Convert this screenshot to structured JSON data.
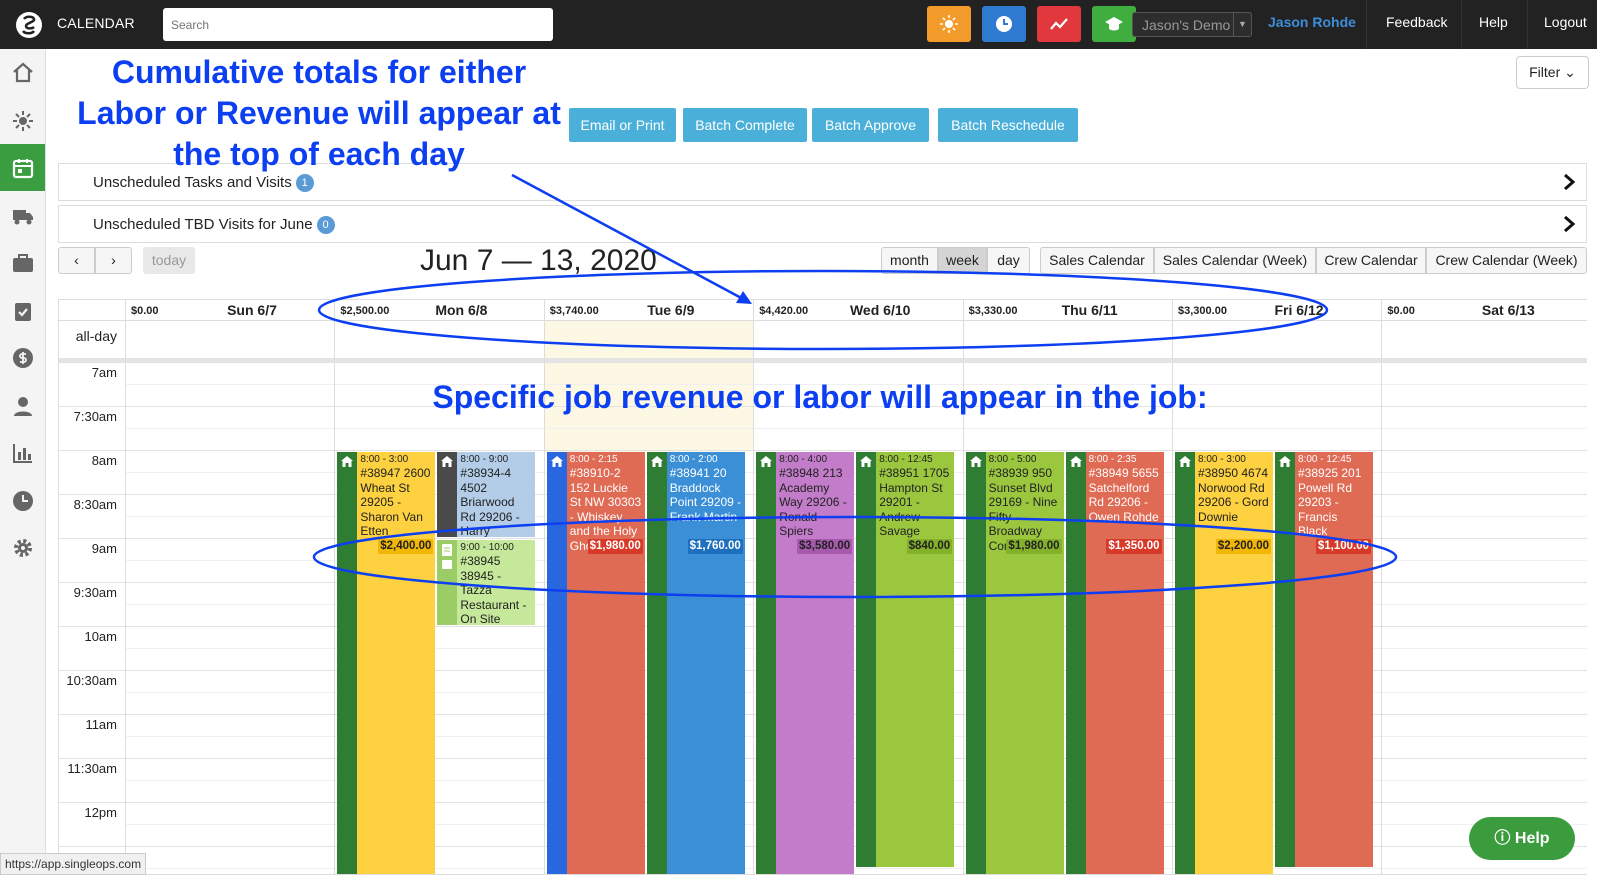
{
  "topbar": {
    "title": "CALENDAR",
    "search_placeholder": "Search",
    "account_select": "Jason's Demo",
    "user": "Jason Rohde",
    "links": [
      "Feedback",
      "Help",
      "Logout"
    ],
    "quick_buttons": [
      {
        "icon": "sun-icon",
        "color": "#f39c2b"
      },
      {
        "icon": "clock-icon",
        "color": "#2f7bd1"
      },
      {
        "icon": "chart-line-icon",
        "color": "#e0383d"
      },
      {
        "icon": "graduation-cap-icon",
        "color": "#3fae3f"
      }
    ]
  },
  "sidebar": {
    "icons": [
      "home-icon",
      "sun-icon",
      "calendar-icon",
      "truck-icon",
      "briefcase-icon",
      "clipboard-check-icon",
      "dollar-icon",
      "user-icon",
      "bar-chart-icon",
      "clock-icon",
      "gear-icon"
    ],
    "active": "calendar-icon",
    "collapse_icon": "arrow-right-icon"
  },
  "filter_label": "Filter",
  "actions": [
    "Email or Print",
    "Batch Complete",
    "Batch Approve",
    "Batch Reschedule"
  ],
  "unscheduled": [
    {
      "label": "Unscheduled Tasks and Visits",
      "count": "1"
    },
    {
      "label": "Unscheduled TBD Visits for June",
      "count": "0"
    }
  ],
  "toolbar": {
    "today": "today",
    "range": "Jun 7 — 13, 2020",
    "views": [
      "month",
      "week",
      "day"
    ],
    "active_view": "week",
    "calendars": [
      "Sales Calendar",
      "Sales Calendar (Week)",
      "Crew Calendar",
      "Crew Calendar (Week)"
    ]
  },
  "calendar": {
    "allday_label": "all-day",
    "days": [
      {
        "total": "$0.00",
        "name": "Sun 6/7"
      },
      {
        "total": "$2,500.00",
        "name": "Mon 6/8"
      },
      {
        "total": "$3,740.00",
        "name": "Tue 6/9"
      },
      {
        "total": "$4,420.00",
        "name": "Wed 6/10"
      },
      {
        "total": "$3,330.00",
        "name": "Thu 6/11"
      },
      {
        "total": "$3,300.00",
        "name": "Fri 6/12"
      },
      {
        "total": "$0.00",
        "name": "Sat 6/13"
      }
    ],
    "times": [
      "7am",
      "7:30am",
      "8am",
      "8:30am",
      "9am",
      "9:30am",
      "10am",
      "10:30am",
      "11am",
      "11:30am",
      "12pm"
    ],
    "events": [
      {
        "day": 1,
        "slot": 0,
        "time": "8:00 - 3:00",
        "text": "#38947 2600 Wheat St 29205 - Sharon Van Etten",
        "amount": "$2,400.00",
        "color": "#fdd13f",
        "strip": "#2e7d32",
        "amount_bg": "#f2b705",
        "light": false
      },
      {
        "day": 1,
        "slot": 1,
        "time": "8:00 - 9:00",
        "text": "#38934-4 4502 Briarwood Rd 29206 - Harry",
        "amount": "",
        "color": "#b3cde8",
        "strip": "#4a4a4a",
        "amount_bg": "",
        "light": false
      },
      {
        "day": 1,
        "slot": 1,
        "time": "9:00 - 10:00",
        "text": "#38945 38945 - Tazza Restaurant - On Site",
        "amount": "",
        "color": "#c5e89a",
        "strip": "#9ccc65",
        "amount_bg": "",
        "light": false
      },
      {
        "day": 2,
        "slot": 0,
        "time": "8:00 - 2:15",
        "text": "#38910-2 152 Luckie St NW 30303 - Whiskey and the Holy Ghost",
        "amount": "$1,980.00",
        "color": "#e06b55",
        "strip": "#2867e0",
        "amount_bg": "#d83a2a",
        "light": true
      },
      {
        "day": 2,
        "slot": 1,
        "time": "8:00 - 2:00",
        "text": "#38941 20 Braddock Point 29209 - Frank Martin",
        "amount": "$1,760.00",
        "color": "#3b8fd6",
        "strip": "#2e7d32",
        "amount_bg": "#1f6fbf",
        "light": true
      },
      {
        "day": 3,
        "slot": 0,
        "time": "8:00 - 4:00",
        "text": "#38948 213 Academy Way 29206 - Ronald Spiers",
        "amount": "$3,580.00",
        "color": "#c27cc9",
        "strip": "#2e7d32",
        "amount_bg": "#a659ad",
        "light": false
      },
      {
        "day": 3,
        "slot": 1,
        "time": "8:00 - 12:45",
        "text": "#38951 1705 Hampton St 29201 - Andrew Savage",
        "amount": "$840.00",
        "color": "#9bc73f",
        "strip": "#2e7d32",
        "amount_bg": "#84b12a",
        "light": false
      },
      {
        "day": 4,
        "slot": 0,
        "time": "8:00 - 5:00",
        "text": "#38939 950 Sunset Blvd 29169 - Nine Fifty Broadway Condos",
        "amount": "$1,980.00",
        "color": "#9bc73f",
        "strip": "#2e7d32",
        "amount_bg": "#84b12a",
        "light": false
      },
      {
        "day": 4,
        "slot": 1,
        "time": "8:00 - 2:35",
        "text": "#38949 5655 Satchelford Rd 29206 - Owen Rohde",
        "amount": "$1,350.00",
        "color": "#e06b55",
        "strip": "#2e7d32",
        "amount_bg": "#d83a2a",
        "light": true
      },
      {
        "day": 5,
        "slot": 0,
        "time": "8:00 - 3:00",
        "text": "#38950 4674 Norwood Rd 29206 - Gord Downie",
        "amount": "$2,200.00",
        "color": "#fdd13f",
        "strip": "#2e7d32",
        "amount_bg": "#f2b705",
        "light": false
      },
      {
        "day": 5,
        "slot": 1,
        "time": "8:00 - 12:45",
        "text": "#38925 201 Powell Rd 29203 - Francis Black",
        "amount": "$1,100.00",
        "color": "#e06b55",
        "strip": "#2e7d32",
        "amount_bg": "#d83a2a",
        "light": true
      }
    ]
  },
  "annotations": {
    "top": "Cumulative totals for either Labor or Revenue will appear at the top of each day",
    "middle": "Specific job revenue or labor will appear in the job:"
  },
  "help_button": "Help",
  "status_url": "https://app.singleops.com"
}
